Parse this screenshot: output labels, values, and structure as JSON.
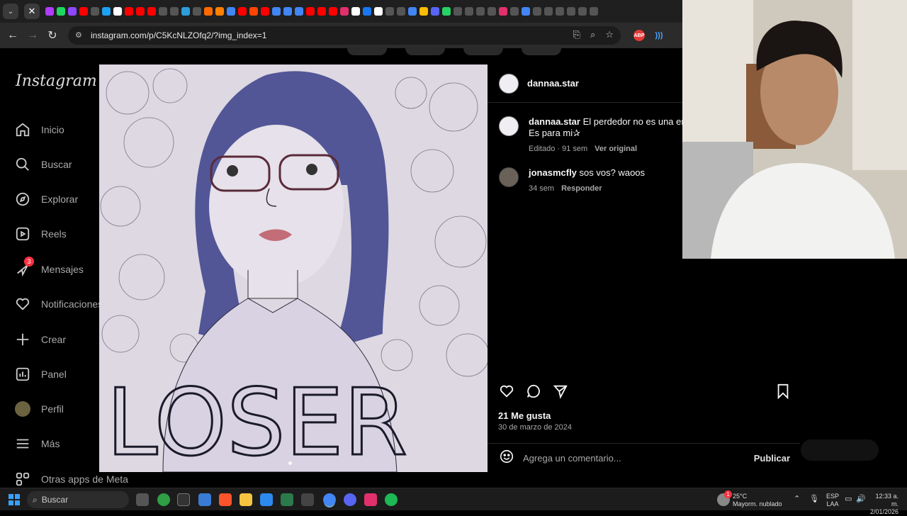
{
  "browser": {
    "url": "instagram.com/p/C5KcNLZOfq2/?img_index=1",
    "ext_abp": "ABP",
    "fav_colors": [
      "#b03cff",
      "#1ed760",
      "#9146ff",
      "#ff0000",
      "#555",
      "#1da1f2",
      "#fff",
      "#ff0000",
      "#ff0000",
      "#ff0000",
      "#555",
      "#555",
      "#2d9cdb",
      "#555",
      "#ff6a00",
      "#ff7f00",
      "#4285f4",
      "#ff0000",
      "#ff4500",
      "#ff0000",
      "#4285f4",
      "#4285f4",
      "#4285f4",
      "#ff0000",
      "#ff0000",
      "#ff0000",
      "#e1306c",
      "#fff",
      "#1877f2",
      "#fff",
      "#555",
      "#555",
      "#4285f4",
      "#fbbc05",
      "#5865f2",
      "#25d366",
      "#555",
      "#555",
      "#555",
      "#555",
      "#e1306c",
      "#555",
      "#4285f4",
      "#555",
      "#555",
      "#555",
      "#555",
      "#555",
      "#555"
    ]
  },
  "sidebar": {
    "logo": "Instagram",
    "items": [
      {
        "label": "Inicio",
        "icon": "home-icon"
      },
      {
        "label": "Buscar",
        "icon": "search-icon"
      },
      {
        "label": "Explorar",
        "icon": "compass-icon"
      },
      {
        "label": "Reels",
        "icon": "reels-icon"
      },
      {
        "label": "Mensajes",
        "icon": "messenger-icon",
        "badge": "3"
      },
      {
        "label": "Notificaciones",
        "icon": "heart-icon"
      },
      {
        "label": "Crear",
        "icon": "plus-icon"
      },
      {
        "label": "Panel",
        "icon": "chart-icon"
      },
      {
        "label": "Perfil",
        "icon": "profile-avatar"
      },
      {
        "label": "Más",
        "icon": "menu-icon"
      },
      {
        "label": "Otras apps de Meta",
        "icon": "apps-icon"
      }
    ]
  },
  "post": {
    "image_text": "LOSER",
    "author": "dannaa.star",
    "caption_user": "dannaa.star",
    "caption_text": "El perdedor no es una emo",
    "caption_line2": "Es para mi✰",
    "caption_meta": "Editado · 91 sem",
    "caption_original": "Ver original",
    "comment_user": "jonasmcfly",
    "comment_text": "sos vos? waoos",
    "comment_age": "34 sem",
    "comment_reply": "Responder",
    "likes": "21 Me gusta",
    "date": "30 de marzo de 2024",
    "comment_placeholder": "Agrega un comentario...",
    "publish": "Publicar"
  },
  "taskbar": {
    "search": "Buscar",
    "weather_temp": "25°C",
    "weather_desc": "Mayorm. nublado",
    "weather_badge": "1",
    "lang1": "ESP",
    "lang2": "LAA",
    "time": "12:33 a. m.",
    "date": "2/01/2026"
  }
}
